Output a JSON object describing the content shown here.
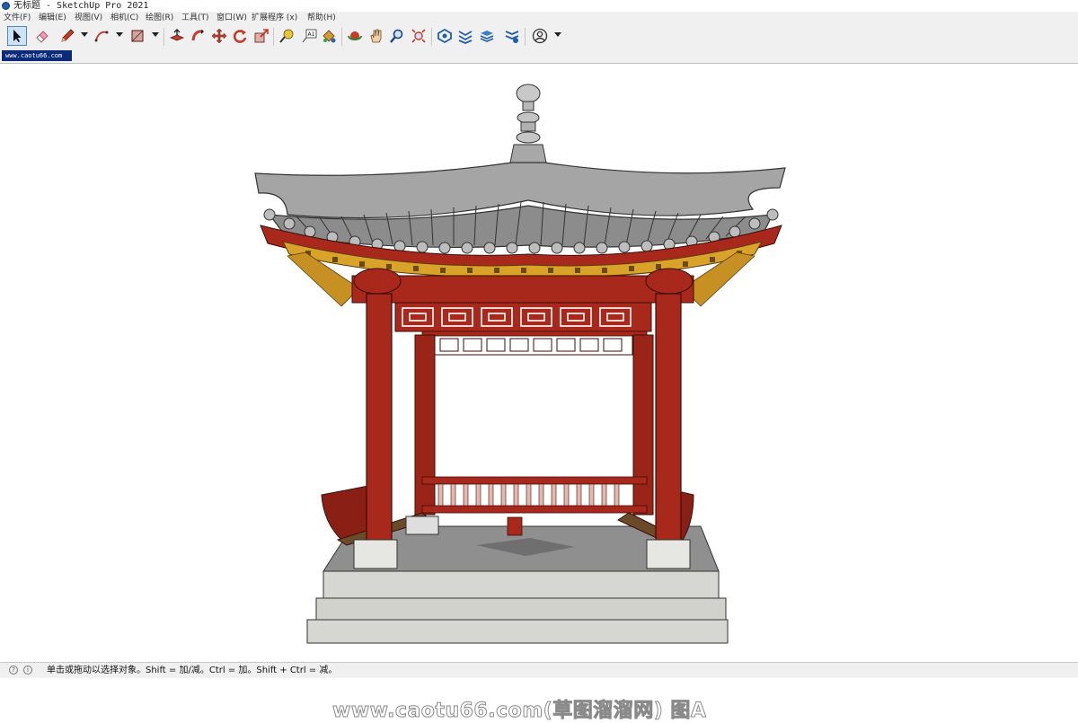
{
  "window": {
    "title": "无标题 - SketchUp Pro 2021"
  },
  "menu": [
    "文件(F)",
    "编辑(E)",
    "视图(V)",
    "相机(C)",
    "绘图(R)",
    "工具(T)",
    "窗口(W)",
    "扩展程序 (x)",
    "帮助(H)"
  ],
  "toolbar": {
    "tools": [
      {
        "icon": "select-arrow-icon"
      },
      {
        "icon": "eraser-icon"
      },
      {
        "icon": "pencil-line-icon"
      },
      {
        "icon": "arc-icon"
      },
      {
        "icon": "rectangle-shape-icon"
      },
      {
        "icon": "push-pull-icon"
      },
      {
        "icon": "follow-me-icon"
      },
      {
        "icon": "move-icon"
      },
      {
        "icon": "rotate-icon"
      },
      {
        "icon": "scale-icon"
      },
      {
        "icon": "tape-measure-icon"
      },
      {
        "icon": "text-label-icon"
      },
      {
        "icon": "paint-bucket-icon"
      },
      {
        "icon": "orbit-icon"
      },
      {
        "icon": "pan-hand-icon"
      },
      {
        "icon": "zoom-icon"
      },
      {
        "icon": "zoom-extents-icon"
      },
      {
        "icon": "warehouse-icon"
      },
      {
        "icon": "extension-warehouse-icon"
      },
      {
        "icon": "layout-icon"
      },
      {
        "icon": "extension-manager-icon"
      },
      {
        "icon": "account-icon"
      }
    ]
  },
  "scene_tab": {
    "label": "www.caotu66.com"
  },
  "viewport": {
    "model": "chinese-pavilion-model",
    "watermark": "www.caotu66.com(草图溜溜网) 图A"
  },
  "status": {
    "message": "单击或拖动以选择对象。Shift = 加/减。Ctrl = 加。Shift + Ctrl = 减。"
  },
  "colors": {
    "pillar": "#a8281c",
    "roof": "#9a9a9a",
    "bracket": "#d8a328",
    "stone": "#d6d6d2",
    "selected_tool": "#cfe3f7"
  }
}
